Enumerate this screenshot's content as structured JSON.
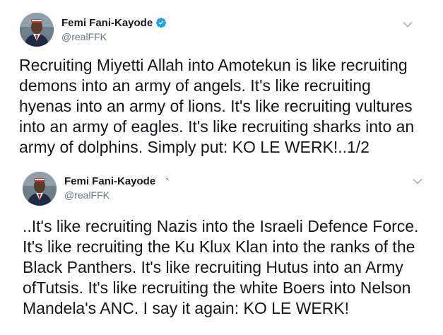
{
  "tweets": [
    {
      "author": {
        "display_name": "Femi Fani-Kayode",
        "handle": "@realFFK",
        "verified": true
      },
      "icons": {
        "verified": "verified-badge-icon",
        "menu": "chevron-down-icon"
      },
      "text": "Recruiting Miyetti Allah into Amotekun is like recruiting\ndemons into an army of angels. It's like recruiting\nhyenas into an army of lions. It's like recruiting vultures\ninto an army of eagles. It's like recruiting sharks into an\narmy of dolphins. Simply put: KO LE WERK!..1/2"
    },
    {
      "author": {
        "display_name": "Femi Fani-Kayode",
        "handle": "@realFFK",
        "verified": true
      },
      "icons": {
        "verified": "verified-badge-icon",
        "menu": "chevron-down-icon"
      },
      "text": "..It's like recruiting Nazis into the Israeli Defence Force.\nIt's like recruiting the Ku Klux Klan into the ranks of the\nBlack Panthers. It's like recruiting Hutus into an Army\nofTutsis. It's like recruiting the white Boers into Nelson\nMandela's ANC.  I say it again: KO LE WERK!"
    }
  ],
  "colors": {
    "text": "#14171a",
    "secondary": "#657786",
    "verified": "#1da1f2",
    "chevron": "#aab8c2"
  }
}
